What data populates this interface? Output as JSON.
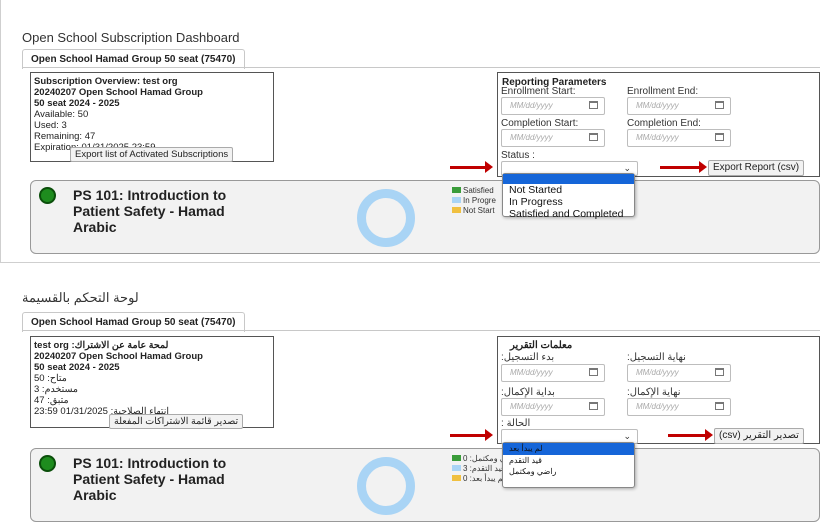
{
  "top": {
    "title": "Open School Subscription Dashboard",
    "tab": "Open School Hamad Group 50 seat (75470)",
    "overview": {
      "line1": "Subscription Overview: test org",
      "line2": "20240207 Open School Hamad Group",
      "line3": "50 seat 2024 - 2025",
      "available": "Available: 50",
      "used": "Used: 3",
      "remaining": "Remaining: 47",
      "expiration": "Expiration: 01/31/2025 23:59",
      "export_button": "Export list of Activated Subscriptions"
    },
    "params": {
      "heading": "Reporting Parameters",
      "enroll_start": "Enrollment Start:",
      "enroll_end": "Enrollment End:",
      "completion_start": "Completion Start:",
      "completion_end": "Completion End:",
      "date_placeholder": "MM/dd/yyyy",
      "status_label": "Status :",
      "export_report": "Export Report (csv)"
    },
    "status_options": [
      "Not Started",
      "In Progress",
      "Satisfied and Completed"
    ],
    "course": {
      "title_line1": "PS 101: Introduction to",
      "title_line2": "Patient Safety - Hamad",
      "title_line3": "Arabic",
      "legend": [
        "Satisfied",
        "In Progre",
        "Not Start"
      ]
    }
  },
  "bottom": {
    "title": "لوحة التحكم بالقسيمة",
    "tab": "Open School Hamad Group 50 seat (75470)",
    "overview": {
      "line1": "test org :لمحة عامة عن الاشتراك",
      "line2": "20240207 Open School Hamad Group",
      "line3": "50 seat 2024 - 2025",
      "available": "متاح: 50",
      "used": "مستخدم: 3",
      "remaining": "متبق: 47",
      "expiration": "انتهاء الصلاحية: 01/31/2025 23:59",
      "export_button": "تصدير قائمة الاشتراكات المفعلة"
    },
    "params": {
      "heading": "معلمات التقرير",
      "enroll_start": ":بدء التسجيل",
      "enroll_end": ":نهاية التسجيل",
      "completion_start": ":بداية الإكمال",
      "completion_end": ":نهاية الإكمال",
      "date_placeholder": "MM/dd/yyyy",
      "status_label": ": الحالة",
      "export_report": "(csv) تصدير التقرير"
    },
    "status_options": [
      "لم يبدأ بعد",
      "قيد التقدم",
      "راضي ومكتمل"
    ],
    "course": {
      "title_line1": "PS 101: Introduction to",
      "title_line2": "Patient Safety - Hamad",
      "title_line3": "Arabic",
      "legend": [
        "راضي ومكتمل: 0",
        "قيد التقدم: 3",
        "لم يبدأ بعد: 0"
      ]
    }
  },
  "colors": {
    "arrow": "#c00000",
    "status_green": "#1e8c1e",
    "donut": "#a9d4f5",
    "dropdown_highlight": "#1565d8",
    "legend_satisfied": "#3a9c3a",
    "legend_progress": "#a9d4f5",
    "legend_notstarted": "#f0c040"
  },
  "icons": [
    "calendar-icon",
    "chevron-down-icon",
    "status-dot-icon",
    "arrow-right-icon"
  ]
}
